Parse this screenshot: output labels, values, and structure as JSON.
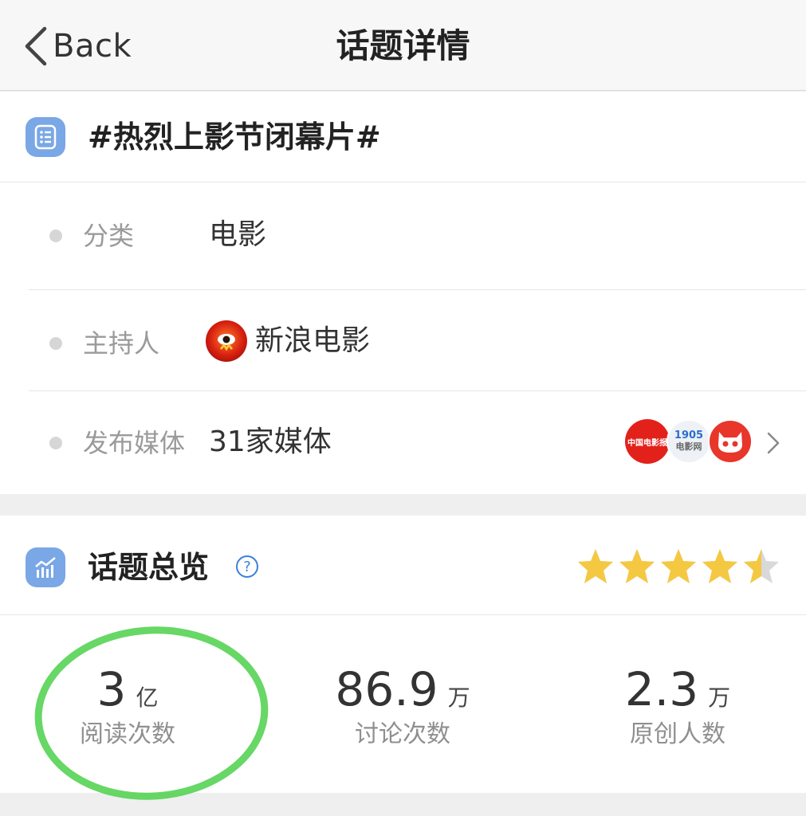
{
  "nav": {
    "back_label": "Back",
    "title": "话题详情"
  },
  "topic": {
    "title": "#热烈上影节闭幕片#"
  },
  "info": {
    "category": {
      "label": "分类",
      "value": "电影"
    },
    "host": {
      "label": "主持人",
      "name": "新浪电影"
    },
    "media": {
      "label": "发布媒体",
      "value": "31家媒体",
      "logos": [
        "中国电影报",
        "1905电影网",
        "猫眼"
      ],
      "logo_b_top": "1905",
      "logo_b_bottom": "电影网",
      "logo_a_text": "中国电影报"
    }
  },
  "overview": {
    "title": "话题总览",
    "help_icon": "question-circle-icon",
    "rating": 4.5,
    "stats": [
      {
        "num": "3",
        "unit": "亿",
        "label": "阅读次数"
      },
      {
        "num": "86.9",
        "unit": "万",
        "label": "讨论次数"
      },
      {
        "num": "2.3",
        "unit": "万",
        "label": "原创人数"
      }
    ]
  },
  "colors": {
    "accent": "#7aa7e6",
    "star": "#f5c842",
    "highlight": "#4cd04a",
    "link": "#3b7fdc"
  }
}
